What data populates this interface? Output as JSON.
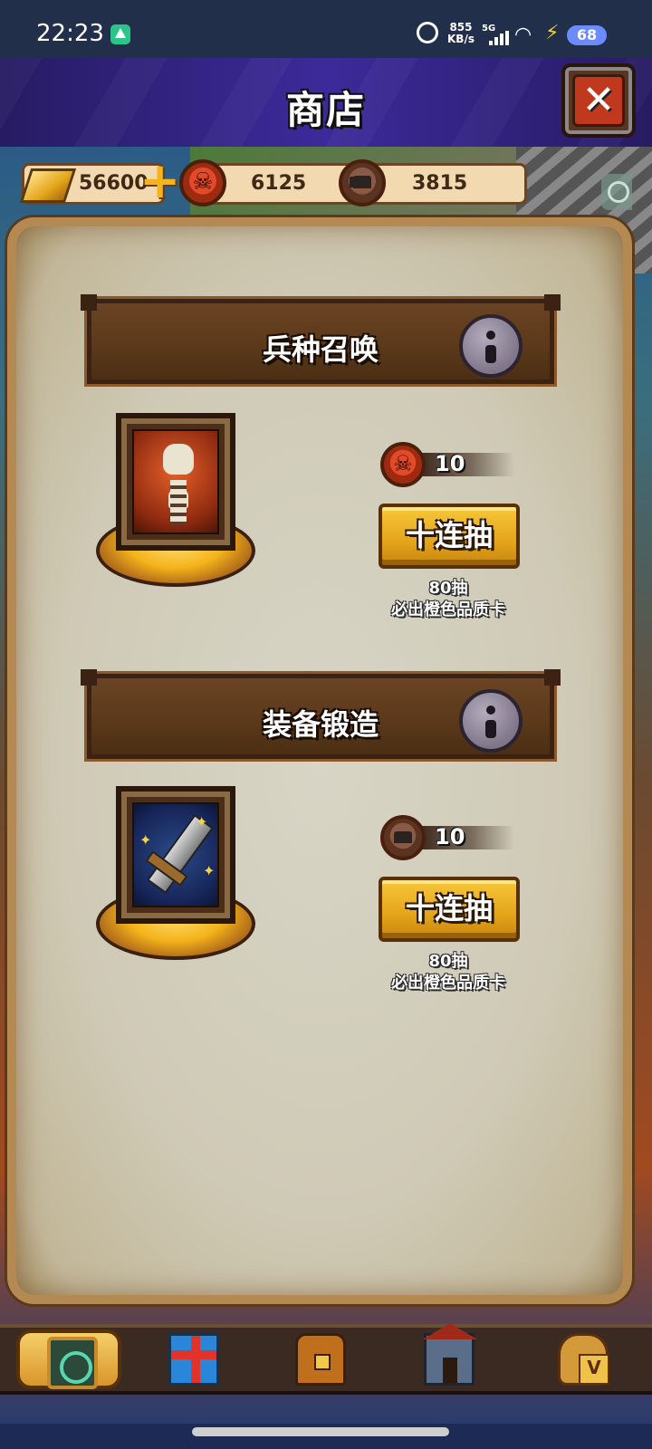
{
  "status_bar": {
    "time": "22:23",
    "net_speed": "855",
    "net_unit": "KB/s",
    "network": "5G",
    "battery": "68"
  },
  "header": {
    "title": "商店"
  },
  "currencies": {
    "gold": "56600",
    "skull_tokens": "6125",
    "anvil_tokens": "3815"
  },
  "sections": [
    {
      "title": "兵种召唤",
      "cost_value": "10",
      "button_label": "十连抽",
      "note_line1": "80抽",
      "note_line2": "必出橙色品质卡",
      "art": "skeleton-warrior-card",
      "cost_icon": "skull-coin-icon"
    },
    {
      "title": "装备锻造",
      "cost_value": "10",
      "button_label": "十连抽",
      "note_line1": "80抽",
      "note_line2": "必出橙色品质卡",
      "art": "sword-card",
      "cost_icon": "anvil-coin-icon"
    }
  ],
  "bottom_nav": [
    {
      "icon": "card-deck-icon",
      "active": true
    },
    {
      "icon": "gift-box-icon",
      "active": false
    },
    {
      "icon": "treasure-chest-icon",
      "active": false
    },
    {
      "icon": "barracks-house-icon",
      "active": false
    },
    {
      "icon": "money-bag-vip-icon",
      "active": false
    }
  ],
  "colors": {
    "header_purple": "#3c2a9a",
    "button_gold": "#e4a41a",
    "banner_brown": "#5a3819",
    "close_red": "#c0391f"
  }
}
